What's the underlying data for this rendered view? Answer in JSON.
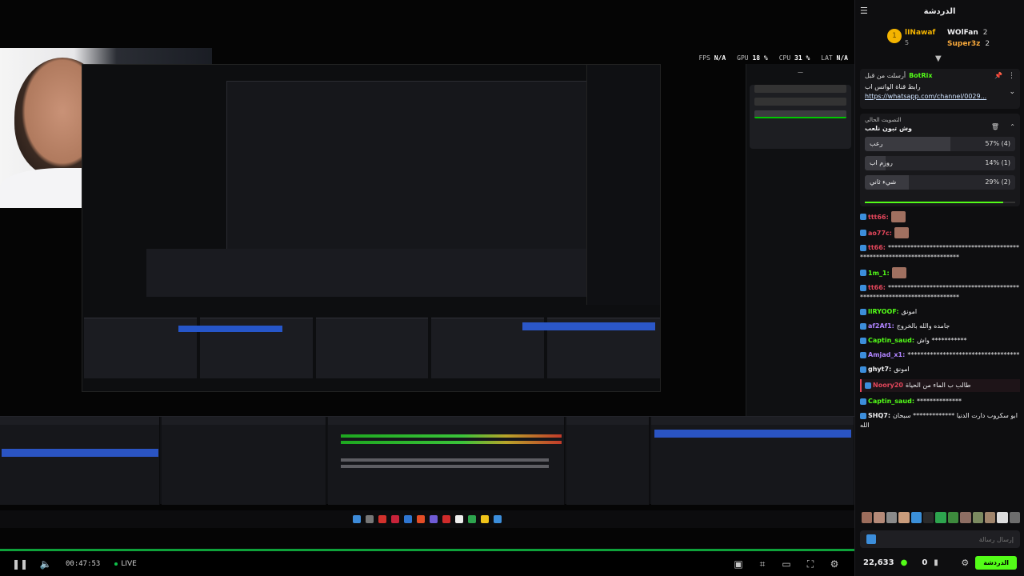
{
  "stream": {
    "stats": [
      {
        "label": "FPS",
        "value": "N/A"
      },
      {
        "label": "GPU",
        "value": "18 %"
      },
      {
        "label": "CPU",
        "value": "31 %"
      },
      {
        "label": "LAT",
        "value": "N/A"
      }
    ],
    "elapsed": "00:47:53",
    "live_label": "LIVE",
    "accent": "#53fc18"
  },
  "chat": {
    "title": "الدردشة",
    "top_gifter": {
      "name": "lINawaf",
      "count": "5"
    },
    "gifters": [
      {
        "name": "WOlFan",
        "count": "2",
        "color": "#efeff1"
      },
      {
        "name": "Super3z",
        "count": "2",
        "color": "#f7a83b"
      }
    ],
    "pinned": {
      "sent_by_label": "أرسلت من قبل",
      "bot_name": "BotRix",
      "message": "رابط قناة الواتس اب",
      "link": "https://whatsapp.com/channel/0029..."
    },
    "poll": {
      "header": "التصويت الحالي",
      "question": "وش تبون نلعب",
      "options": [
        {
          "label": "رعب",
          "result": "57% (4)",
          "fraction": 0.57
        },
        {
          "label": "روزم اب",
          "result": "14% (1)",
          "fraction": 0.14
        },
        {
          "label": "شيء ثاني",
          "result": "29% (2)",
          "fraction": 0.29
        }
      ]
    },
    "messages": [
      {
        "user": "ttt66:",
        "color": "#e3465b",
        "text": ""
      },
      {
        "user": "ao77c:",
        "color": "#e3465b",
        "text": ""
      },
      {
        "user": "tt66:",
        "color": "#e3465b",
        "text": "************************************************************************"
      },
      {
        "user": "1m_1:",
        "color": "#53fc18",
        "text": ""
      },
      {
        "user": "tt66:",
        "color": "#e3465b",
        "text": "************************************************************************"
      },
      {
        "user": "llRYOOF:",
        "color": "#53fc18",
        "text": "امونق"
      },
      {
        "user": "af2Af1:",
        "color": "#b084ff",
        "text": "جامده والله بالخروج"
      },
      {
        "user": "Captin_saud:",
        "color": "#53fc18",
        "text": "واش ***********"
      },
      {
        "user": "Amjad_x1:",
        "color": "#b084ff",
        "text": "***********************************"
      },
      {
        "user": "ghyt7:",
        "color": "#efeff1",
        "text": "امونق"
      },
      {
        "user": "Noory20",
        "color": "#e3465b",
        "text": "طالب ب الماء من الحياة"
      },
      {
        "user": "Captin_saud:",
        "color": "#53fc18",
        "text": "**************"
      },
      {
        "user": "SHQ7:",
        "color": "#efeff1",
        "text": "ابو سكروب دارت الدنيا ************* سبحان الله"
      }
    ],
    "input_placeholder": "إرسال رسالة",
    "viewers": "22,633",
    "points": "0",
    "send_label": "الدردشة"
  }
}
